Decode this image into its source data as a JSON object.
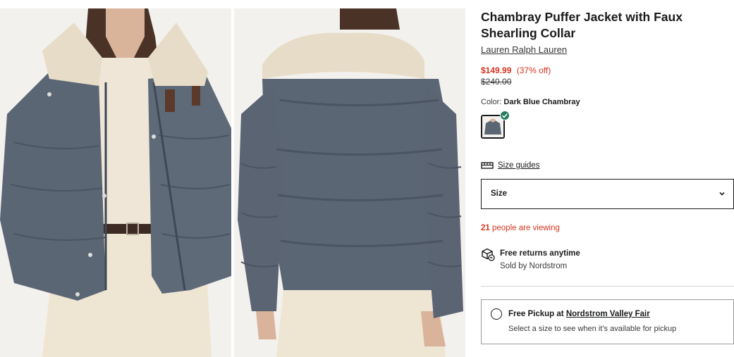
{
  "product": {
    "title": "Chambray Puffer Jacket with Faux Shearling Collar",
    "brand": "Lauren Ralph Lauren",
    "price": {
      "sale": "$149.99",
      "discount": "(37% off)",
      "original": "$240.00"
    },
    "color": {
      "label": "Color:",
      "selected": "Dark Blue Chambray"
    },
    "size_guides_label": "Size guides",
    "size_select_label": "Size",
    "viewing": {
      "count": "21",
      "text": " people are viewing"
    },
    "returns": {
      "title": "Free returns anytime",
      "sold_by": "Sold by Nordstrom"
    },
    "pickup": {
      "prefix": "Free Pickup at ",
      "store": "Nordstrom Valley Fair",
      "note": "Select a size to see when it’s available for pickup"
    }
  },
  "colors": {
    "sale_red": "#d6351e",
    "check_green": "#1f7a5c",
    "text": "#191a1b",
    "jacket": "#5b6675",
    "collar": "#e7dcc8"
  },
  "icons": [
    "size-guide-icon",
    "chevron-down-icon",
    "returns-box-icon",
    "check-icon"
  ]
}
